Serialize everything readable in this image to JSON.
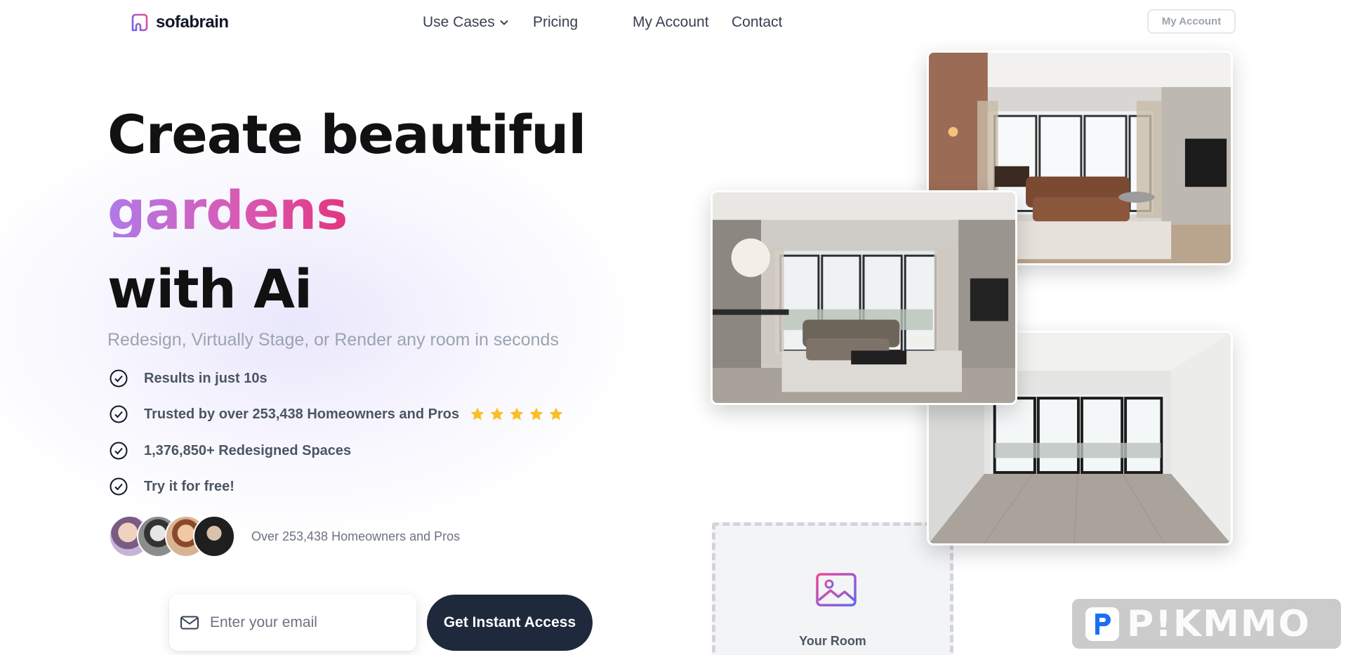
{
  "header": {
    "logo_text": "sofabrain",
    "nav": [
      {
        "label": "Use Cases",
        "has_dropdown": true
      },
      {
        "label": "Pricing"
      },
      {
        "label": "My Account"
      },
      {
        "label": "Contact"
      }
    ],
    "account_button": "My Account"
  },
  "hero": {
    "title_line1": "Create beautiful",
    "title_highlight": "gardens",
    "title_line3": "with Ai",
    "subtitle": "Redesign, Virtually Stage, or Render any room in seconds",
    "features": [
      "Results in just 10s",
      "Trusted by over 253,438 Homeowners and Pros",
      "1,376,850+ Redesigned Spaces",
      "Try it for free!"
    ],
    "star_rating": 5,
    "social_proof": "Over 253,438 Homeowners and Pros",
    "email_placeholder": "Enter your email",
    "cta_label": "Get Instant Access"
  },
  "gallery": {
    "upload_label": "Your Room"
  },
  "watermark": {
    "text": "P!KMMO"
  },
  "colors": {
    "gradient_start": "#b07ae8",
    "gradient_end": "#e3357e",
    "cta_bg": "#1e293b",
    "star": "#fbbf24",
    "upload_icon_start": "#ec4899",
    "upload_icon_end": "#6366f1"
  }
}
